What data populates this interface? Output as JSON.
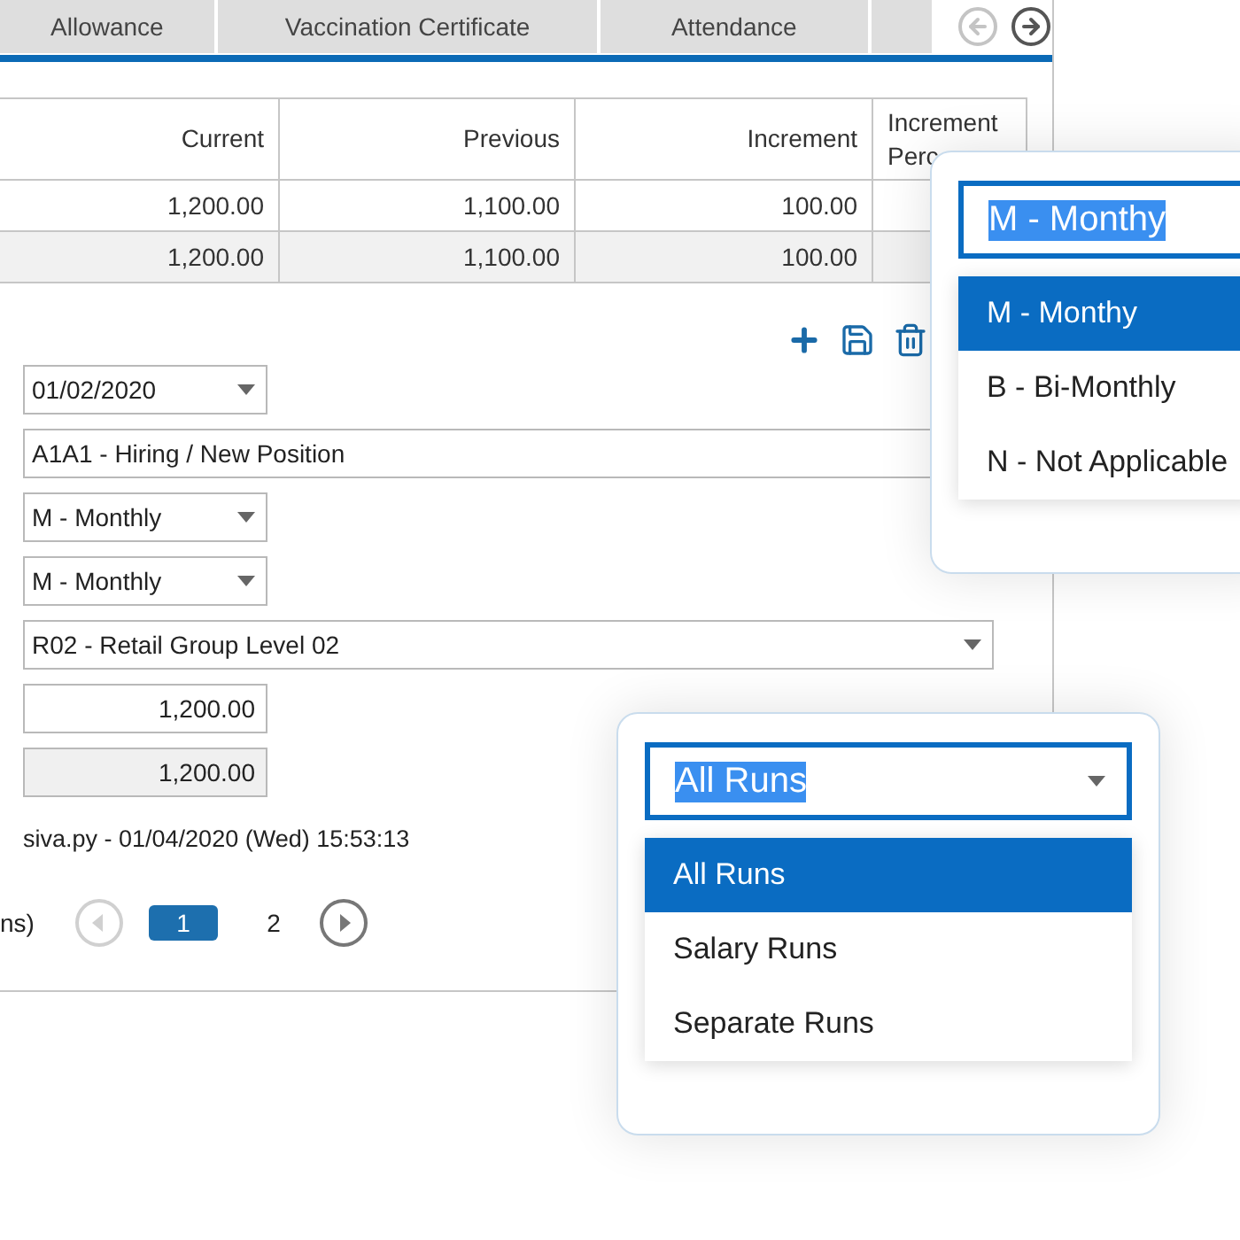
{
  "tabs": [
    {
      "label": "Allowance",
      "selected": false
    },
    {
      "label": "Vaccination Certificate",
      "selected": false
    },
    {
      "label": "Attendance",
      "selected": false
    }
  ],
  "tab_nav": {
    "prev_disabled": true,
    "next_disabled": false
  },
  "table": {
    "columns": [
      "Current",
      "Previous",
      "Increment",
      "Increment Perc"
    ],
    "rows": [
      {
        "cells": [
          "1,200.00",
          "1,100.00",
          "100.00"
        ]
      },
      {
        "cells": [
          "1,200.00",
          "1,100.00",
          "100.00"
        ]
      }
    ]
  },
  "form": {
    "fields": [
      {
        "kind": "dropdown",
        "value": "01/02/2020"
      },
      {
        "kind": "text",
        "value": "A1A1 - Hiring / New Position"
      },
      {
        "kind": "dropdown",
        "value": "M - Monthly"
      },
      {
        "kind": "dropdown",
        "value": "M - Monthly"
      },
      {
        "kind": "dropdown",
        "value": "R02 - Retail Group Level 02"
      },
      {
        "kind": "number",
        "value": "1,200.00"
      },
      {
        "kind": "readonly",
        "value": "1,200.00"
      }
    ],
    "audit": "siva.py - 01/04/2020 (Wed) 15:53:13"
  },
  "pagination": {
    "label": "ns)",
    "prev_disabled": true,
    "next_disabled": false,
    "pages": [
      {
        "label": "1",
        "selected": true
      },
      {
        "label": "2",
        "selected": false
      }
    ]
  },
  "frequency_popup": {
    "value": "M - Monthy",
    "highlighted": true,
    "options": [
      {
        "label": "M - Monthy",
        "selected": true
      },
      {
        "label": "B - Bi-Monthly",
        "selected": false
      },
      {
        "label": "N - Not Applicable",
        "selected": false
      }
    ]
  },
  "runs_popup": {
    "value": "All Runs",
    "highlighted": true,
    "options": [
      {
        "label": "All Runs",
        "selected": true
      },
      {
        "label": "Salary Runs",
        "selected": false
      },
      {
        "label": "Separate Runs",
        "selected": false
      }
    ]
  }
}
